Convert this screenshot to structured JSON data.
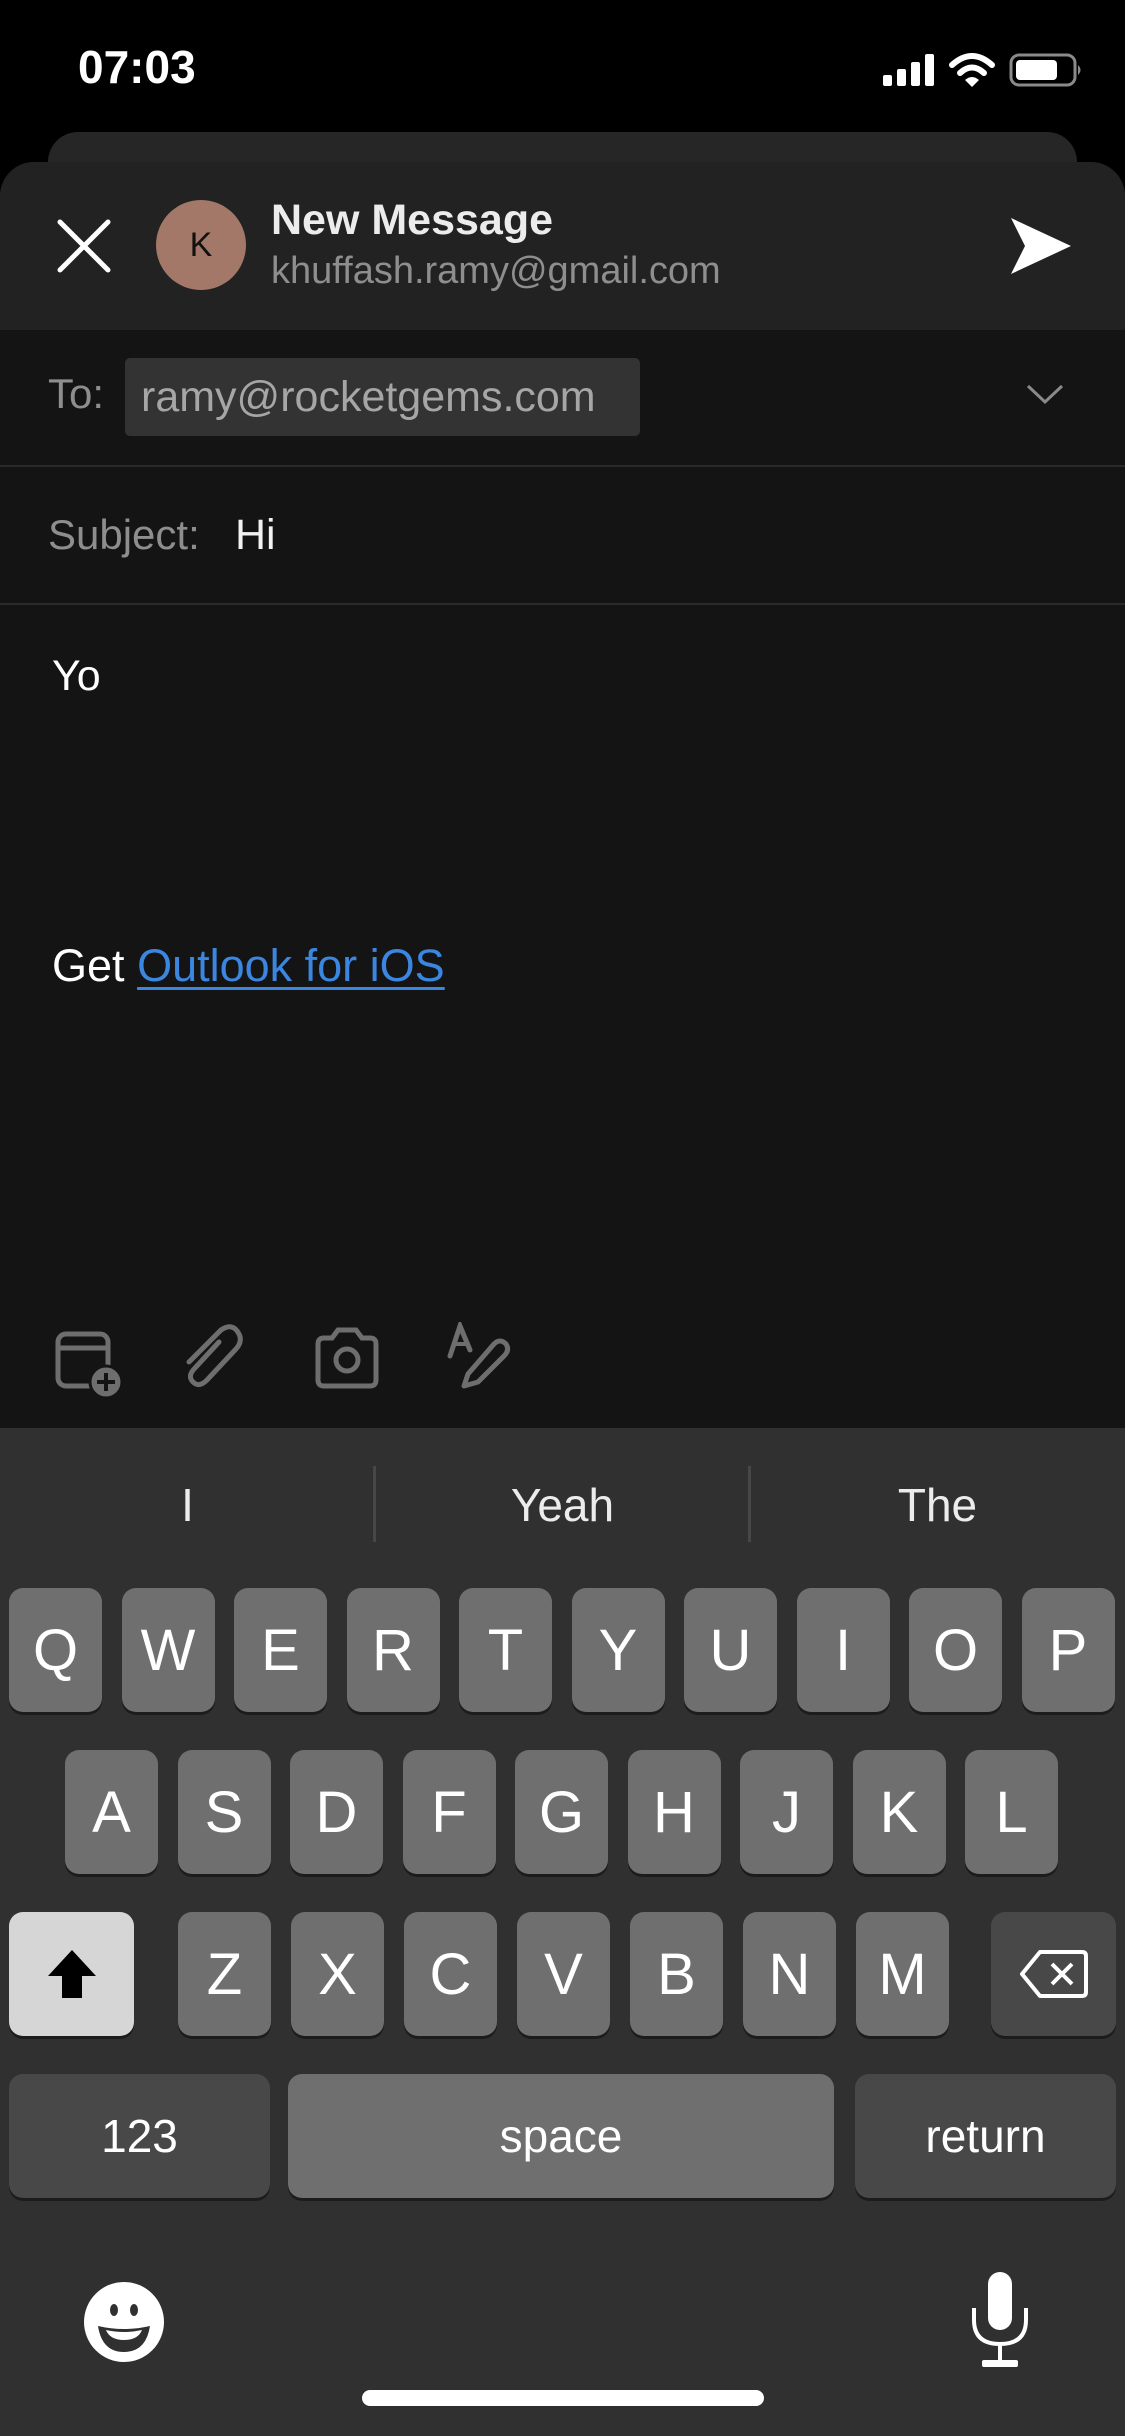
{
  "status_bar": {
    "time": "07:03",
    "icons": [
      "cellular-signal-icon",
      "wifi-icon",
      "battery-icon"
    ],
    "battery_level_percent": 75
  },
  "compose": {
    "title": "New Message",
    "account": "khuffash.ramy@gmail.com",
    "avatar_initial": "K",
    "avatar_color": "#a47868",
    "to_label": "To:",
    "to_recipient": "ramy@rocketgems.com",
    "subject_label": "Subject:",
    "subject_value": "Hi",
    "body": "Yo",
    "signature_prefix": "Get",
    "signature_link": "Outlook for iOS",
    "link_color": "#3a86e0"
  },
  "toolbar": {
    "icons": [
      "calendar-add-icon",
      "paperclip-icon",
      "camera-icon",
      "text-format-pen-icon"
    ]
  },
  "keyboard": {
    "suggestions": [
      "I",
      "Yeah",
      "The"
    ],
    "row1": [
      "Q",
      "W",
      "E",
      "R",
      "T",
      "Y",
      "U",
      "I",
      "O",
      "P"
    ],
    "row2": [
      "A",
      "S",
      "D",
      "F",
      "G",
      "H",
      "J",
      "K",
      "L"
    ],
    "row3": [
      "Z",
      "X",
      "C",
      "V",
      "B",
      "N",
      "M"
    ],
    "numbers_label": "123",
    "space_label": "space",
    "return_label": "return"
  }
}
